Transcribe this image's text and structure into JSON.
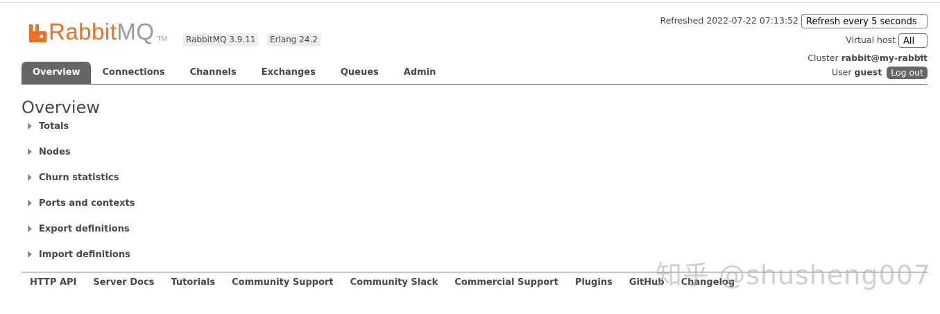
{
  "logo": {
    "brand_primary": "Rabbit",
    "brand_secondary": "MQ",
    "tm": "TM",
    "color": "#f16f22"
  },
  "versions": {
    "rabbitmq": "RabbitMQ 3.9.11",
    "erlang": "Erlang 24.2"
  },
  "status": {
    "refreshed_label": "Refreshed 2022-07-22 07:13:52",
    "refresh_select": "Refresh every 5 seconds",
    "vhost_label": "Virtual host",
    "vhost_select": "All",
    "cluster_label": "Cluster",
    "cluster_name": "rabbit@my-rabbit",
    "user_label": "User",
    "user_name": "guest",
    "logout": "Log out"
  },
  "tabs": [
    {
      "label": "Overview",
      "active": true
    },
    {
      "label": "Connections",
      "active": false
    },
    {
      "label": "Channels",
      "active": false
    },
    {
      "label": "Exchanges",
      "active": false
    },
    {
      "label": "Queues",
      "active": false
    },
    {
      "label": "Admin",
      "active": false
    }
  ],
  "page_title": "Overview",
  "sections": [
    {
      "label": "Totals"
    },
    {
      "label": "Nodes"
    },
    {
      "label": "Churn statistics"
    },
    {
      "label": "Ports and contexts"
    },
    {
      "label": "Export definitions"
    },
    {
      "label": "Import definitions"
    }
  ],
  "footer": [
    {
      "label": "HTTP API"
    },
    {
      "label": "Server Docs"
    },
    {
      "label": "Tutorials"
    },
    {
      "label": "Community Support"
    },
    {
      "label": "Community Slack"
    },
    {
      "label": "Commercial Support"
    },
    {
      "label": "Plugins"
    },
    {
      "label": "GitHub"
    },
    {
      "label": "Changelog"
    }
  ],
  "watermark": "知乎 @shusheng007"
}
